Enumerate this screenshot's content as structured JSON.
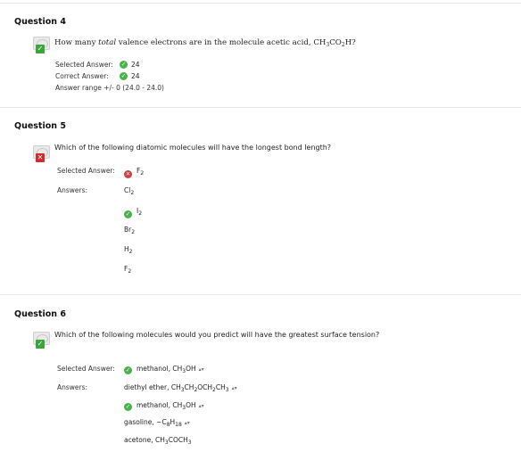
{
  "questions": [
    {
      "title": "Question 4",
      "prompt": "How many total valence electrons are in the molecule acetic acid, CH3CO2H?",
      "selected_label": "Selected Answer:",
      "selected_value": "24",
      "correct_label": "Correct Answer:",
      "correct_value": "24",
      "range_text": "Answer range +/- 0 (24.0 - 24.0)",
      "status": "correct"
    },
    {
      "title": "Question 5",
      "prompt": "Which of the following diatomic molecules will have the longest bond length?",
      "selected_label": "Selected Answer:",
      "selected_value": "F2",
      "answers_label": "Answers:",
      "answers": [
        "Cl2",
        "I2",
        "Br2",
        "H2",
        "F2"
      ],
      "correct_index": 1,
      "status": "incorrect"
    },
    {
      "title": "Question 6",
      "prompt": "Which of the following molecules would you predict will have the greatest surface tension?",
      "selected_label": "Selected Answer:",
      "selected_value": "methanol, CH3OH",
      "answers_label": "Answers:",
      "answers": [
        "diethyl ether, CH3CH2OCH2CH3",
        "methanol, CH3OH",
        "gasoline, ~C8H18",
        "acetone, CH3COCH3"
      ],
      "correct_index": 1,
      "status": "correct"
    }
  ],
  "icons": {
    "correct_badge": "check-icon",
    "incorrect_badge": "x-icon",
    "selector": "up-down-arrows-icon"
  },
  "colors": {
    "correct": "#3aa53a",
    "incorrect": "#d12b2b"
  }
}
